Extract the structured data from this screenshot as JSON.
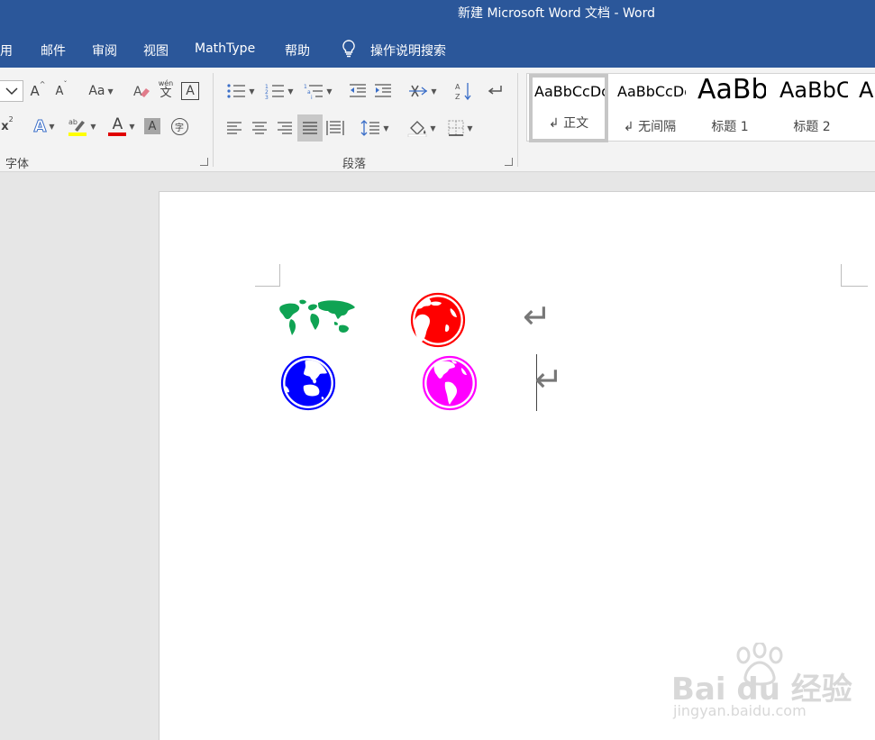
{
  "window": {
    "title": "新建 Microsoft Word 文档  -  Word"
  },
  "menu": {
    "items": [
      "用",
      "邮件",
      "审阅",
      "视图",
      "MathType",
      "帮助"
    ],
    "search_label": "操作说明搜索"
  },
  "ribbon": {
    "font_group_label": "字体",
    "paragraph_group_label": "段落",
    "font_buttons": {
      "change_case": "Aa",
      "phonetic": "wén\n文",
      "char_border": "A",
      "text_effects": "A",
      "font_color": "A",
      "char_shading": "A",
      "enclose": "字"
    },
    "styles": [
      {
        "sample": "AaBbCcDc",
        "label": "↲ 正文"
      },
      {
        "sample": "AaBbCcDc",
        "label": "↲ 无间隔"
      },
      {
        "sample": "AaBb",
        "label": "标题 1"
      },
      {
        "sample": "AaBbC",
        "label": "标题 2"
      },
      {
        "sample": "A",
        "label": ""
      }
    ]
  },
  "colors": {
    "ribbon_blue": "#2b579a",
    "globe_green": "#0fa353",
    "globe_red": "#ff0000",
    "globe_blue": "#0000ff",
    "globe_magenta": "#ff00ff"
  },
  "document": {
    "paragraph_mark": "↵",
    "icons": [
      "world-map-icon",
      "globe-africa-icon",
      "globe-asia-icon",
      "globe-americas-icon"
    ]
  },
  "watermark": {
    "brand": "Bai du 经验",
    "url": "jingyan.baidu.com"
  }
}
